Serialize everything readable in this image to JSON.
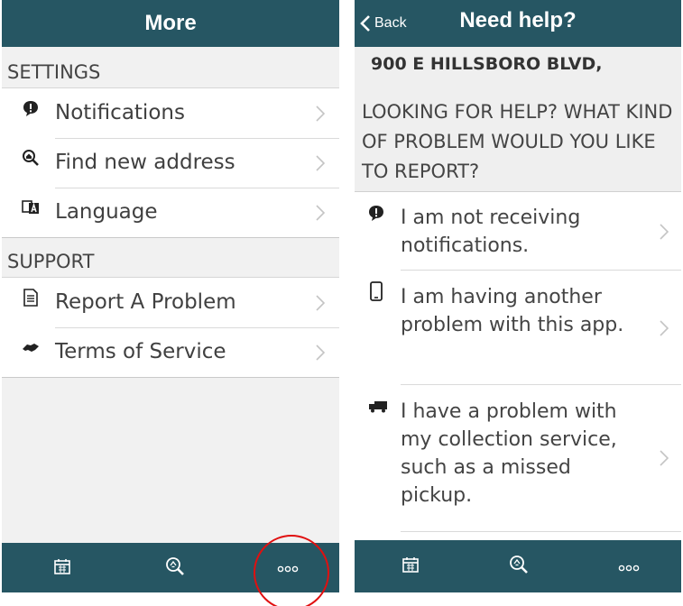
{
  "left_screen": {
    "title": "More",
    "sections": [
      {
        "header": "SETTINGS",
        "items": [
          {
            "label": "Notifications",
            "icon": "alert-bubble-icon"
          },
          {
            "label": "Find new address",
            "icon": "home-search-icon"
          },
          {
            "label": "Language",
            "icon": "translate-icon"
          }
        ]
      },
      {
        "header": "SUPPORT",
        "items": [
          {
            "label": "Report A Problem",
            "icon": "document-icon"
          },
          {
            "label": "Terms of Service",
            "icon": "handshake-icon"
          }
        ]
      }
    ]
  },
  "right_screen": {
    "back_label": "Back",
    "title": "Need help?",
    "address": "900 E HILLSBORO BLVD,",
    "question": "LOOKING FOR HELP? WHAT KIND OF PROBLEM WOULD YOU LIKE TO REPORT?",
    "options": [
      {
        "label": "I am not receiving notifications.",
        "icon": "alert-bubble-icon"
      },
      {
        "label": "I am having another problem with this app.",
        "icon": "phone-icon"
      },
      {
        "label": "I have a problem with my collection service, such as a missed pickup.",
        "icon": "garbage-truck-icon"
      }
    ]
  },
  "tab_bar": {
    "tabs": [
      {
        "icon": "calendar-icon"
      },
      {
        "icon": "recycle-search-icon"
      },
      {
        "icon": "more-dots-icon"
      }
    ]
  },
  "colors": {
    "nav_bar": "#265663",
    "annotation_circle": "#e01010"
  }
}
